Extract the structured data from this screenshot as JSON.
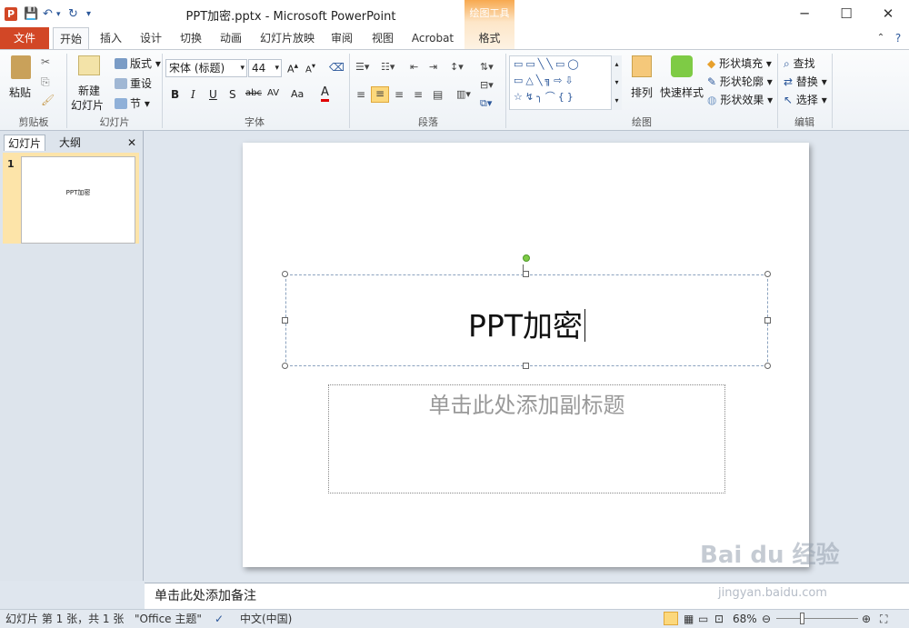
{
  "window": {
    "title": "PPT加密.pptx - Microsoft PowerPoint",
    "minimize": "─",
    "maximize": "☐",
    "close": "✕"
  },
  "qat": {
    "app_icon": "P",
    "save": "💾",
    "undo": "↶",
    "redo": "↻",
    "customize": "▾"
  },
  "context_tab": {
    "group": "绘图工具",
    "tab": "格式"
  },
  "tabs": [
    "文件",
    "开始",
    "插入",
    "设计",
    "切换",
    "动画",
    "幻灯片放映",
    "审阅",
    "视图",
    "Acrobat"
  ],
  "active_tab": "开始",
  "ribbon": {
    "clipboard": {
      "paste": "粘贴",
      "label": "剪贴板"
    },
    "slides": {
      "new_slide_line1": "新建",
      "new_slide_line2": "幻灯片",
      "layout": "版式",
      "reset": "重设",
      "section": "节",
      "label": "幻灯片"
    },
    "font": {
      "font_name": "宋体 (标题)",
      "font_size": "44",
      "bold": "B",
      "italic": "I",
      "underline": "U",
      "shadow": "S",
      "strike": "abc",
      "spacing": "AV",
      "case": "Aa",
      "color": "A",
      "label": "字体"
    },
    "paragraph": {
      "label": "段落"
    },
    "drawing": {
      "arrange": "排列",
      "quick_styles": "快速样式",
      "shape_fill": "形状填充",
      "shape_outline": "形状轮廓",
      "shape_effects": "形状效果",
      "label": "绘图"
    },
    "editing": {
      "find": "查找",
      "replace": "替换",
      "select": "选择",
      "label": "编辑"
    }
  },
  "left_pane": {
    "tab_slides": "幻灯片",
    "tab_outline": "大纲",
    "close": "✕",
    "slide_number": "1",
    "thumb_title": "PPT加密"
  },
  "slide": {
    "title": "PPT加密",
    "subtitle_placeholder": "单击此处添加副标题"
  },
  "notes_placeholder": "单击此处添加备注",
  "status": {
    "slide_info": "幻灯片 第 1 张，共 1 张",
    "theme": "\"Office 主题\"",
    "language": "中文(中国)",
    "zoom": "68%",
    "zoom_minus": "⊖",
    "zoom_plus": "⊕"
  },
  "watermark": {
    "brand": "Bai du 经验",
    "url": "jingyan.baidu.com"
  },
  "colors": {
    "file_tab": "#d24726",
    "accent": "#2b579a",
    "context_tab": "#f7a94f",
    "rotate_handle": "#7ecb45"
  }
}
